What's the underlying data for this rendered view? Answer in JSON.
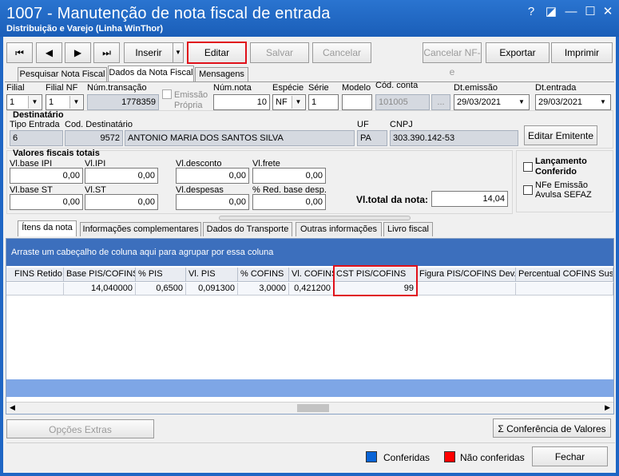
{
  "window": {
    "title": "1007 - Manutenção de nota fiscal de entrada",
    "subtitle": "Distribuição e Varejo (Linha WinThor)",
    "help_glyph": "?",
    "restore_glyph": "◪",
    "minimize_glyph": "—",
    "maximize_glyph": "☐",
    "close_glyph": "✕"
  },
  "toolbar": {
    "first": "⏮",
    "prev": "◀",
    "next": "▶",
    "last": "⏭",
    "inserir": "Inserir",
    "inserir_dd": "▼",
    "editar": "Editar",
    "salvar": "Salvar",
    "cancelar": "Cancelar",
    "cancelar_nfe": "Cancelar NF-e",
    "exportar": "Exportar",
    "imprimir": "Imprimir"
  },
  "tabs": [
    "Pesquisar Nota Fiscal",
    "Dados da Nota Fiscal",
    "Mensagens"
  ],
  "form": {
    "filial_label": "Filial",
    "filial_value": "1",
    "filial_nf_label": "Filial NF",
    "filial_nf_value": "1",
    "num_transacao_label": "Núm.transação",
    "num_transacao_value": "1778359",
    "emissao_propria_label1": "Emissão",
    "emissao_propria_label2": "Própria",
    "num_nota_label": "Núm.nota",
    "num_nota_value": "10",
    "especie_label": "Espécie",
    "especie_value": "NF",
    "serie_label": "Série",
    "serie_value": "1",
    "modelo_label": "Modelo",
    "modelo_value": "",
    "cod_conta_label": "Cód. conta",
    "cod_conta_value": "101005",
    "ellipsis": "...",
    "dt_emissao_label": "Dt.emissão",
    "dt_emissao_value": "29/03/2021",
    "dt_entrada_label": "Dt.entrada",
    "dt_entrada_value": "29/03/2021"
  },
  "destinatario": {
    "title": "Destinatário",
    "tipo_entrada_label": "Tipo Entrada",
    "tipo_entrada_value": "6",
    "cod_dest_label": "Cod. Destinatário",
    "cod_dest_value": "9572",
    "nome_value": "ANTONIO  MARIA DOS SANTOS SILVA",
    "uf_label": "UF",
    "uf_value": "PA",
    "cnpj_label": "CNPJ",
    "cnpj_value": "303.390.142-53",
    "editar_emitente": "Editar Emitente"
  },
  "valores": {
    "title": "Valores fiscais totais",
    "vl_base_ipi_label": "Vl.base IPI",
    "vl_base_ipi_value": "0,00",
    "vl_ipi_label": "Vl.IPI",
    "vl_ipi_value": "0,00",
    "vl_desconto_label": "Vl.desconto",
    "vl_desconto_value": "0,00",
    "vl_frete_label": "Vl.frete",
    "vl_frete_value": "0,00",
    "vl_base_st_label": "Vl.base ST",
    "vl_base_st_value": "0,00",
    "vl_st_label": "Vl.ST",
    "vl_st_value": "0,00",
    "vl_despesas_label": "Vl.despesas",
    "vl_despesas_value": "0,00",
    "red_base_label": "% Red. base desp.",
    "red_base_value": "0,00",
    "vl_total_label": "Vl.total da nota:",
    "vl_total_value": "14,04"
  },
  "side": {
    "lancamento1": "Lançamento",
    "lancamento2": "Conferido",
    "nfe1": "NFe Emissão",
    "nfe2": "Avulsa SEFAZ"
  },
  "subtabs": [
    "Ítens da nota",
    "Informações complementares",
    "Dados do Transporte",
    "Outras informações",
    "Livro fiscal"
  ],
  "grid": {
    "group_hint": "Arraste um cabeçalho de coluna aqui para agrupar por essa coluna",
    "columns": [
      "FINS Retido",
      "Base PIS/COFINS",
      "% PIS",
      "Vl. PIS",
      "% COFINS",
      "Vl. COFINS",
      "CST PIS/COFINS",
      "Figura PIS/COFINS Dev.",
      "Percentual COFINS Suspe"
    ],
    "row": [
      "",
      "14,040000",
      "0,6500",
      "0,091300",
      "3,0000",
      "0,421200",
      "99",
      "",
      ""
    ]
  },
  "footer": {
    "opcoes_extras": "Opções Extras",
    "conferencia": "Conferência de Valores",
    "conferidas": "Conferidas",
    "nao_conferidas": "Não conferidas",
    "fechar": "Fechar"
  },
  "colors": {
    "title_blue": "#1f66c4",
    "highlight_red": "#e0101a",
    "conferidas": "#0a64d6",
    "nao_conferidas": "#ff0000"
  }
}
